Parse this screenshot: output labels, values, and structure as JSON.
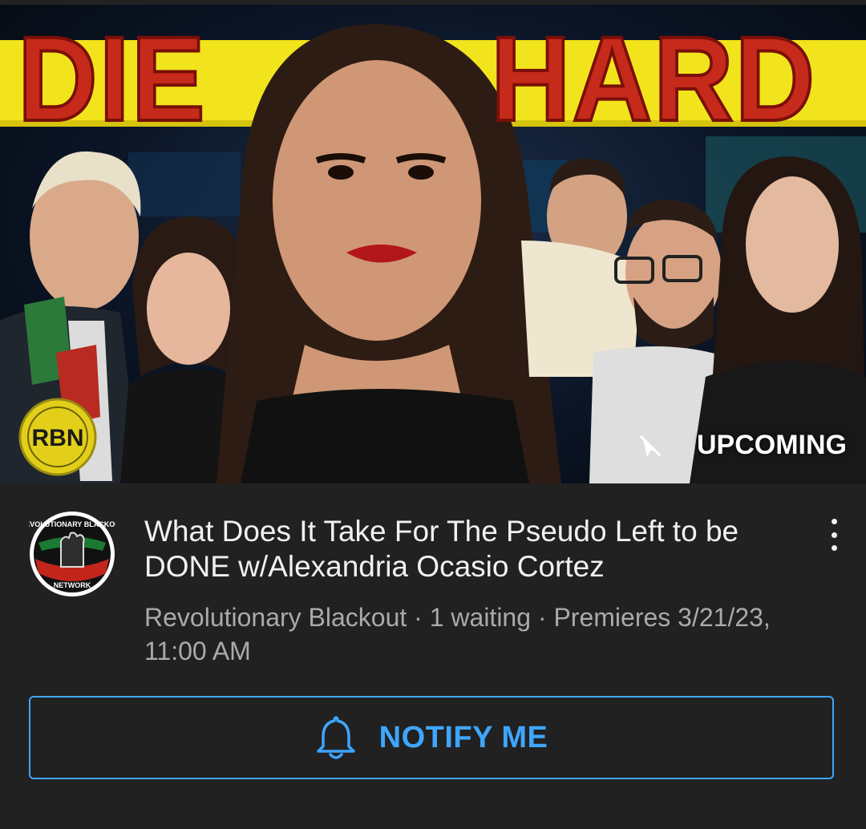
{
  "thumbnail": {
    "headline_left": "DIE",
    "headline_right": "HARD",
    "logo_text": "RBN",
    "badge_label": "UPCOMING",
    "badge_icon": "no-live-icon"
  },
  "video": {
    "title": "What Does It Take For The Pseudo Left to be DONE w/Alexandria Ocasio Cortez",
    "meta": "Revolutionary Blackout · 1 waiting · Premieres 3/21/23, 11:00 AM"
  },
  "channel": {
    "avatar_text_top": "REVOLUTIONARY BLACKOUT",
    "avatar_text_bottom": "NETWORK"
  },
  "notify_button": {
    "label": "NOTIFY ME",
    "icon": "bell-icon"
  },
  "colors": {
    "background": "#212121",
    "accent_blue": "#3ea6ff",
    "headline_red": "#c62a1a",
    "meta_gray": "#aaaaaa"
  }
}
